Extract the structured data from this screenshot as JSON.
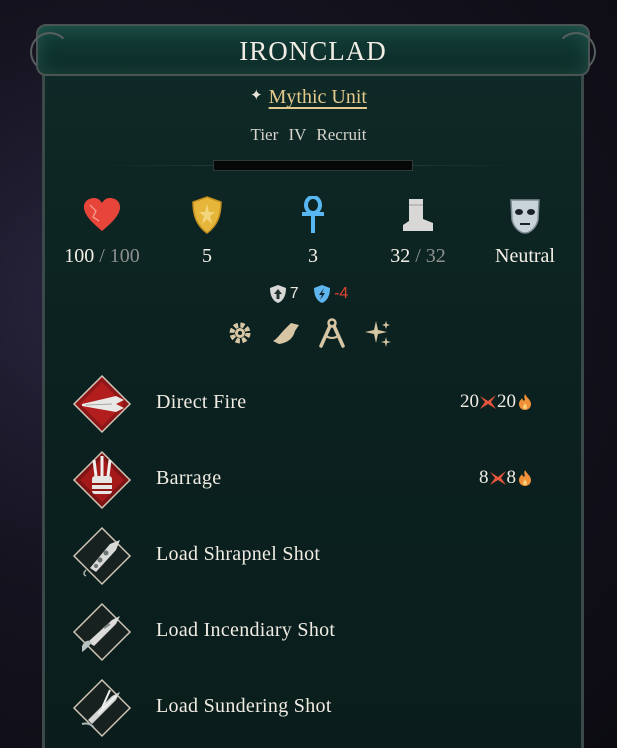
{
  "unit": {
    "name": "IRONCLAD",
    "rarity": "Mythic Unit",
    "tier": "Tier IV",
    "rank": "Recruit",
    "xp_progress": 0
  },
  "stats": {
    "health": {
      "current": "100",
      "separator": "/",
      "max": "100",
      "icon": "heart-icon"
    },
    "defense": {
      "value": "5",
      "icon": "shield-icon"
    },
    "resistance": {
      "value": "3",
      "icon": "ankh-icon"
    },
    "movement": {
      "current": "32",
      "separator": "/",
      "max": "32",
      "icon": "boot-icon"
    },
    "morale": {
      "value": "Neutral",
      "icon": "mask-icon"
    }
  },
  "modifiers": [
    {
      "value": "7",
      "icon": "armor-up-icon"
    },
    {
      "value": "-4",
      "icon": "resistance-down-icon"
    }
  ],
  "traits": [
    "gear-icon",
    "boot-wing-icon",
    "compass-icon",
    "sparkle-icon"
  ],
  "abilities": [
    {
      "name": "Direct Fire",
      "dmg_a": "20",
      "dmg_b": "20"
    },
    {
      "name": "Barrage",
      "dmg_a": "8",
      "dmg_b": "8"
    },
    {
      "name": "Load Shrapnel Shot"
    },
    {
      "name": "Load Incendiary Shot"
    },
    {
      "name": "Load Sundering Shot"
    }
  ],
  "colors": {
    "panel": "#0b2220",
    "gold": "#e3c98c",
    "negative": "#e2452e",
    "ability_red": "#9b1b1b"
  }
}
